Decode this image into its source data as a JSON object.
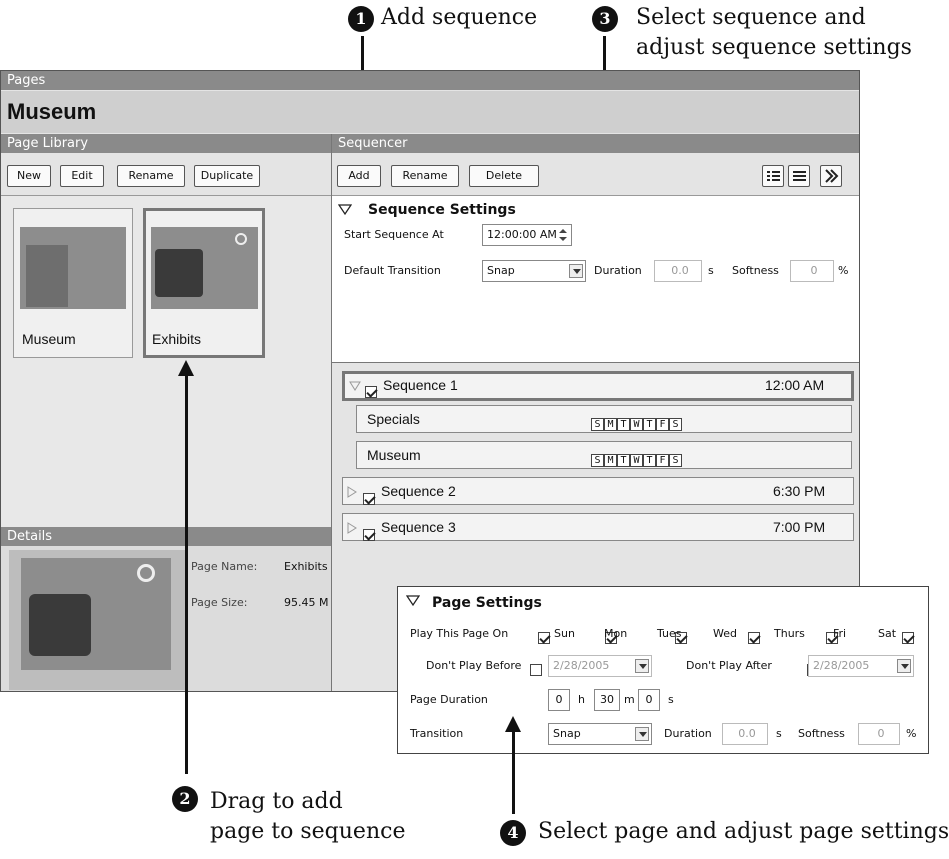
{
  "callouts": {
    "c1": {
      "num": "1",
      "text": "Add sequence"
    },
    "c2": {
      "num": "2",
      "line1": "Drag to add",
      "line2": "page to sequence"
    },
    "c3": {
      "num": "3",
      "line1": "Select sequence and",
      "line2": "adjust sequence settings"
    },
    "c4": {
      "num": "4",
      "text": "Select page and adjust page settings"
    }
  },
  "app": {
    "pages_header": "Pages",
    "title": "Museum",
    "library": {
      "header": "Page Library",
      "buttons": {
        "new": "New",
        "edit": "Edit",
        "rename": "Rename",
        "duplicate": "Duplicate"
      },
      "pages": [
        {
          "label": "Museum",
          "selected": false
        },
        {
          "label": "Exhibits",
          "selected": true
        }
      ]
    },
    "details": {
      "header": "Details",
      "page_name_label": "Page Name:",
      "page_name_value": "Exhibits",
      "page_size_label": "Page Size:",
      "page_size_value": "95.45 M"
    },
    "sequencer": {
      "header": "Sequencer",
      "buttons": {
        "add": "Add",
        "rename": "Rename",
        "delete": "Delete"
      },
      "settings": {
        "title": "Sequence Settings",
        "start_label": "Start Sequence At",
        "start_value": "12:00:00 AM",
        "transition_label": "Default Transition",
        "transition_value": "Snap",
        "duration_label": "Duration",
        "duration_value": "0.0",
        "duration_unit": "s",
        "softness_label": "Softness",
        "softness_value": "0",
        "softness_unit": "%"
      },
      "sequences": [
        {
          "name": "Sequence 1",
          "time": "12:00 AM"
        },
        {
          "name": "Sequence 2",
          "time": "6:30 PM"
        },
        {
          "name": "Sequence 3",
          "time": "7:00 PM"
        }
      ],
      "pages_in_seq": [
        {
          "name": "Specials",
          "days": [
            "S",
            "M",
            "T",
            "W",
            "T",
            "F",
            "S"
          ]
        },
        {
          "name": "Museum",
          "days": [
            "S",
            "M",
            "T",
            "W",
            "T",
            "F",
            "S"
          ]
        }
      ]
    }
  },
  "page_settings": {
    "title": "Page Settings",
    "play_on_label": "Play This Page On",
    "days": [
      "Sun",
      "Mon",
      "Tues",
      "Wed",
      "Thurs",
      "Fri",
      "Sat"
    ],
    "dont_before_label": "Don't Play Before",
    "dont_before_value": "2/28/2005",
    "dont_after_label": "Don't Play After",
    "dont_after_value": "2/28/2005",
    "duration_label": "Page Duration",
    "hours": "0",
    "h_unit": "h",
    "minutes": "30",
    "m_unit": "m",
    "seconds": "0",
    "s_unit": "s",
    "transition_label": "Transition",
    "transition_value": "Snap",
    "t_duration_label": "Duration",
    "t_duration_value": "0.0",
    "t_duration_unit": "s",
    "softness_label": "Softness",
    "softness_value": "0",
    "softness_unit": "%"
  }
}
